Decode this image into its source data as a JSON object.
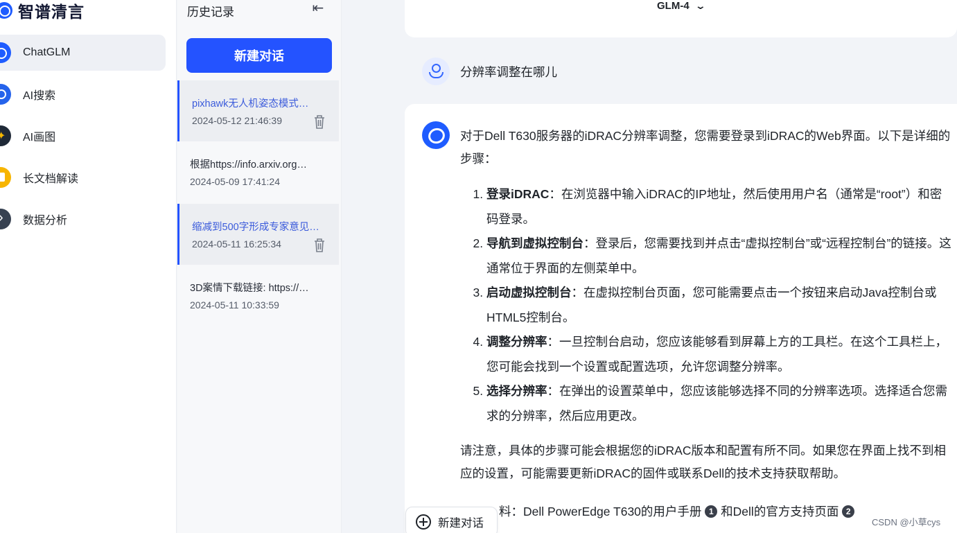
{
  "app": {
    "name": "智谱清言"
  },
  "nav": {
    "items": [
      {
        "label": "ChatGLM",
        "icon": "chatglm-icon",
        "active": true
      },
      {
        "label": "AI搜索",
        "icon": "ai-search-icon",
        "active": false
      },
      {
        "label": "AI画图",
        "icon": "ai-draw-icon",
        "active": false
      },
      {
        "label": "长文档解读",
        "icon": "document-icon",
        "active": false
      },
      {
        "label": "数据分析",
        "icon": "data-analysis-icon",
        "active": false
      }
    ]
  },
  "history": {
    "title": "历史记录",
    "new_chat_label": "新建对话",
    "conversations": [
      {
        "title": "pixhawk无人机姿态模式…",
        "date": "2024-05-12 21:46:39",
        "selected": true
      },
      {
        "title": "根据https://info.arxiv.org…",
        "date": "2024-05-09 17:41:24",
        "selected": false
      },
      {
        "title": "缩减到500字形成专家意见…",
        "date": "2024-05-11 16:25:34",
        "selected": true
      },
      {
        "title": "3D案情下载链接: https://…",
        "date": "2024-05-11 10:33:59",
        "selected": false
      }
    ]
  },
  "main": {
    "model": "GLM-4",
    "user_message": "分辨率调整在哪儿",
    "answer": {
      "intro": "对于Dell T630服务器的iDRAC分辨率调整，您需要登录到iDRAC的Web界面。以下是详细的步骤：",
      "steps": [
        {
          "title": "登录iDRAC",
          "text": "：在浏览器中输入iDRAC的IP地址，然后使用用户名（通常是“root”）和密码登录。"
        },
        {
          "title": "导航到虚拟控制台",
          "text": "：登录后，您需要找到并点击“虚拟控制台”或“远程控制台”的链接。这通常位于界面的左侧菜单中。"
        },
        {
          "title": "启动虚拟控制台",
          "text": "：在虚拟控制台页面，您可能需要点击一个按钮来启动Java控制台或HTML5控制台。"
        },
        {
          "title": "调整分辨率",
          "text": "：一旦控制台启动，您应该能够看到屏幕上方的工具栏。在这个工具栏上，您可能会找到一个设置或配置选项，允许您调整分辨率。"
        },
        {
          "title": "选择分辨率",
          "text": "：在弹出的设置菜单中，您应该能够选择不同的分辨率选项。选择适合您需求的分辨率，然后应用更改。"
        }
      ],
      "note": "请注意，具体的步骤可能会根据您的iDRAC版本和配置有所不同。如果您在界面上找不到相应的设置，可能需要更新iDRAC的固件或联系Dell的技术支持获取帮助。",
      "ref_prefix": "料：Dell PowerEdge T630的用户手册",
      "ref_num_1": "1",
      "ref_middle": "和Dell的官方支持页面",
      "ref_num_2": "2"
    },
    "float_new_chat_label": "新建对话",
    "credit": "CSDN @小草cys"
  }
}
